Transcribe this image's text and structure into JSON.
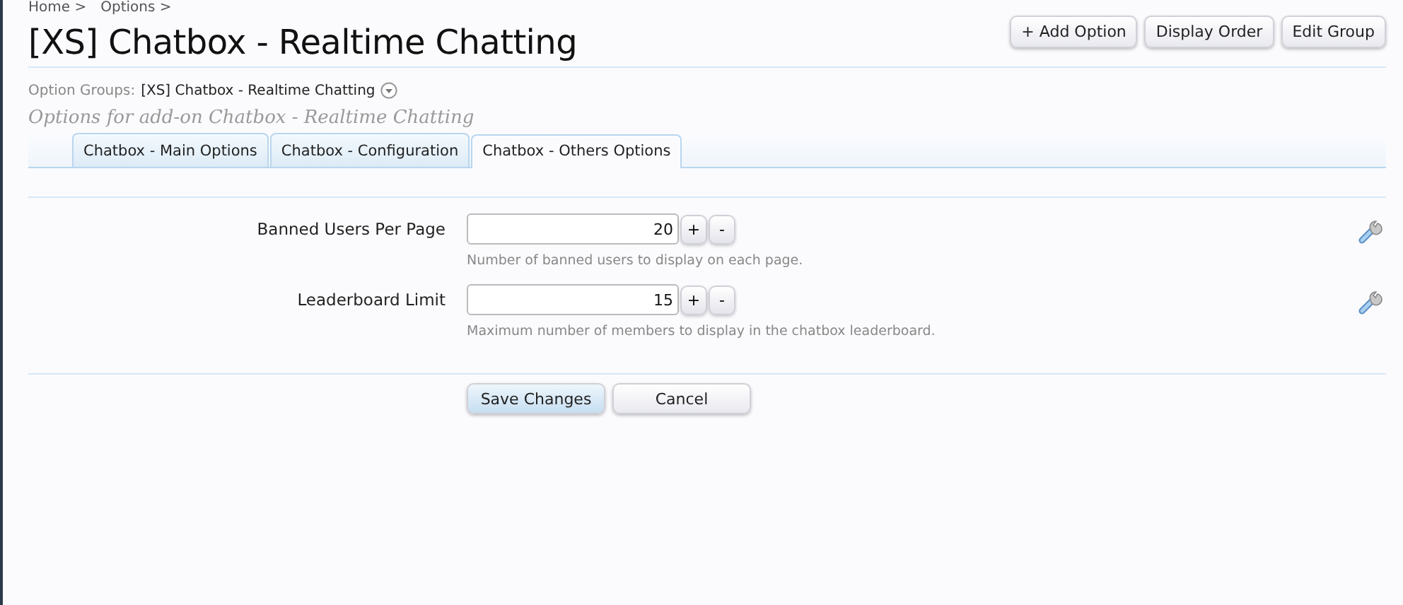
{
  "breadcrumb": [
    "Home >",
    "Options >"
  ],
  "title": "[XS] Chatbox - Realtime Chatting",
  "top_buttons": [
    "+ Add Option",
    "Display Order",
    "Edit Group"
  ],
  "option_groups": {
    "label": "Option Groups:",
    "value": "[XS] Chatbox - Realtime Chatting"
  },
  "subtitle": "Options for add-on Chatbox - Realtime Chatting",
  "tabs": [
    {
      "label": "Chatbox - Main Options",
      "selected": false
    },
    {
      "label": "Chatbox - Configuration",
      "selected": false
    },
    {
      "label": "Chatbox - Others Options",
      "selected": true
    }
  ],
  "options": [
    {
      "label": "Banned Users Per Page",
      "value": "20",
      "increment": "+",
      "decrement": "-",
      "hint": "Number of banned users to display on each page."
    },
    {
      "label": "Leaderboard Limit",
      "value": "15",
      "increment": "+",
      "decrement": "-",
      "hint": "Maximum number of members to display in the chatbox leaderboard."
    }
  ],
  "buttons": [
    {
      "label": "Save Changes",
      "kind": "primary"
    },
    {
      "label": "Cancel",
      "kind": "secondary"
    }
  ]
}
